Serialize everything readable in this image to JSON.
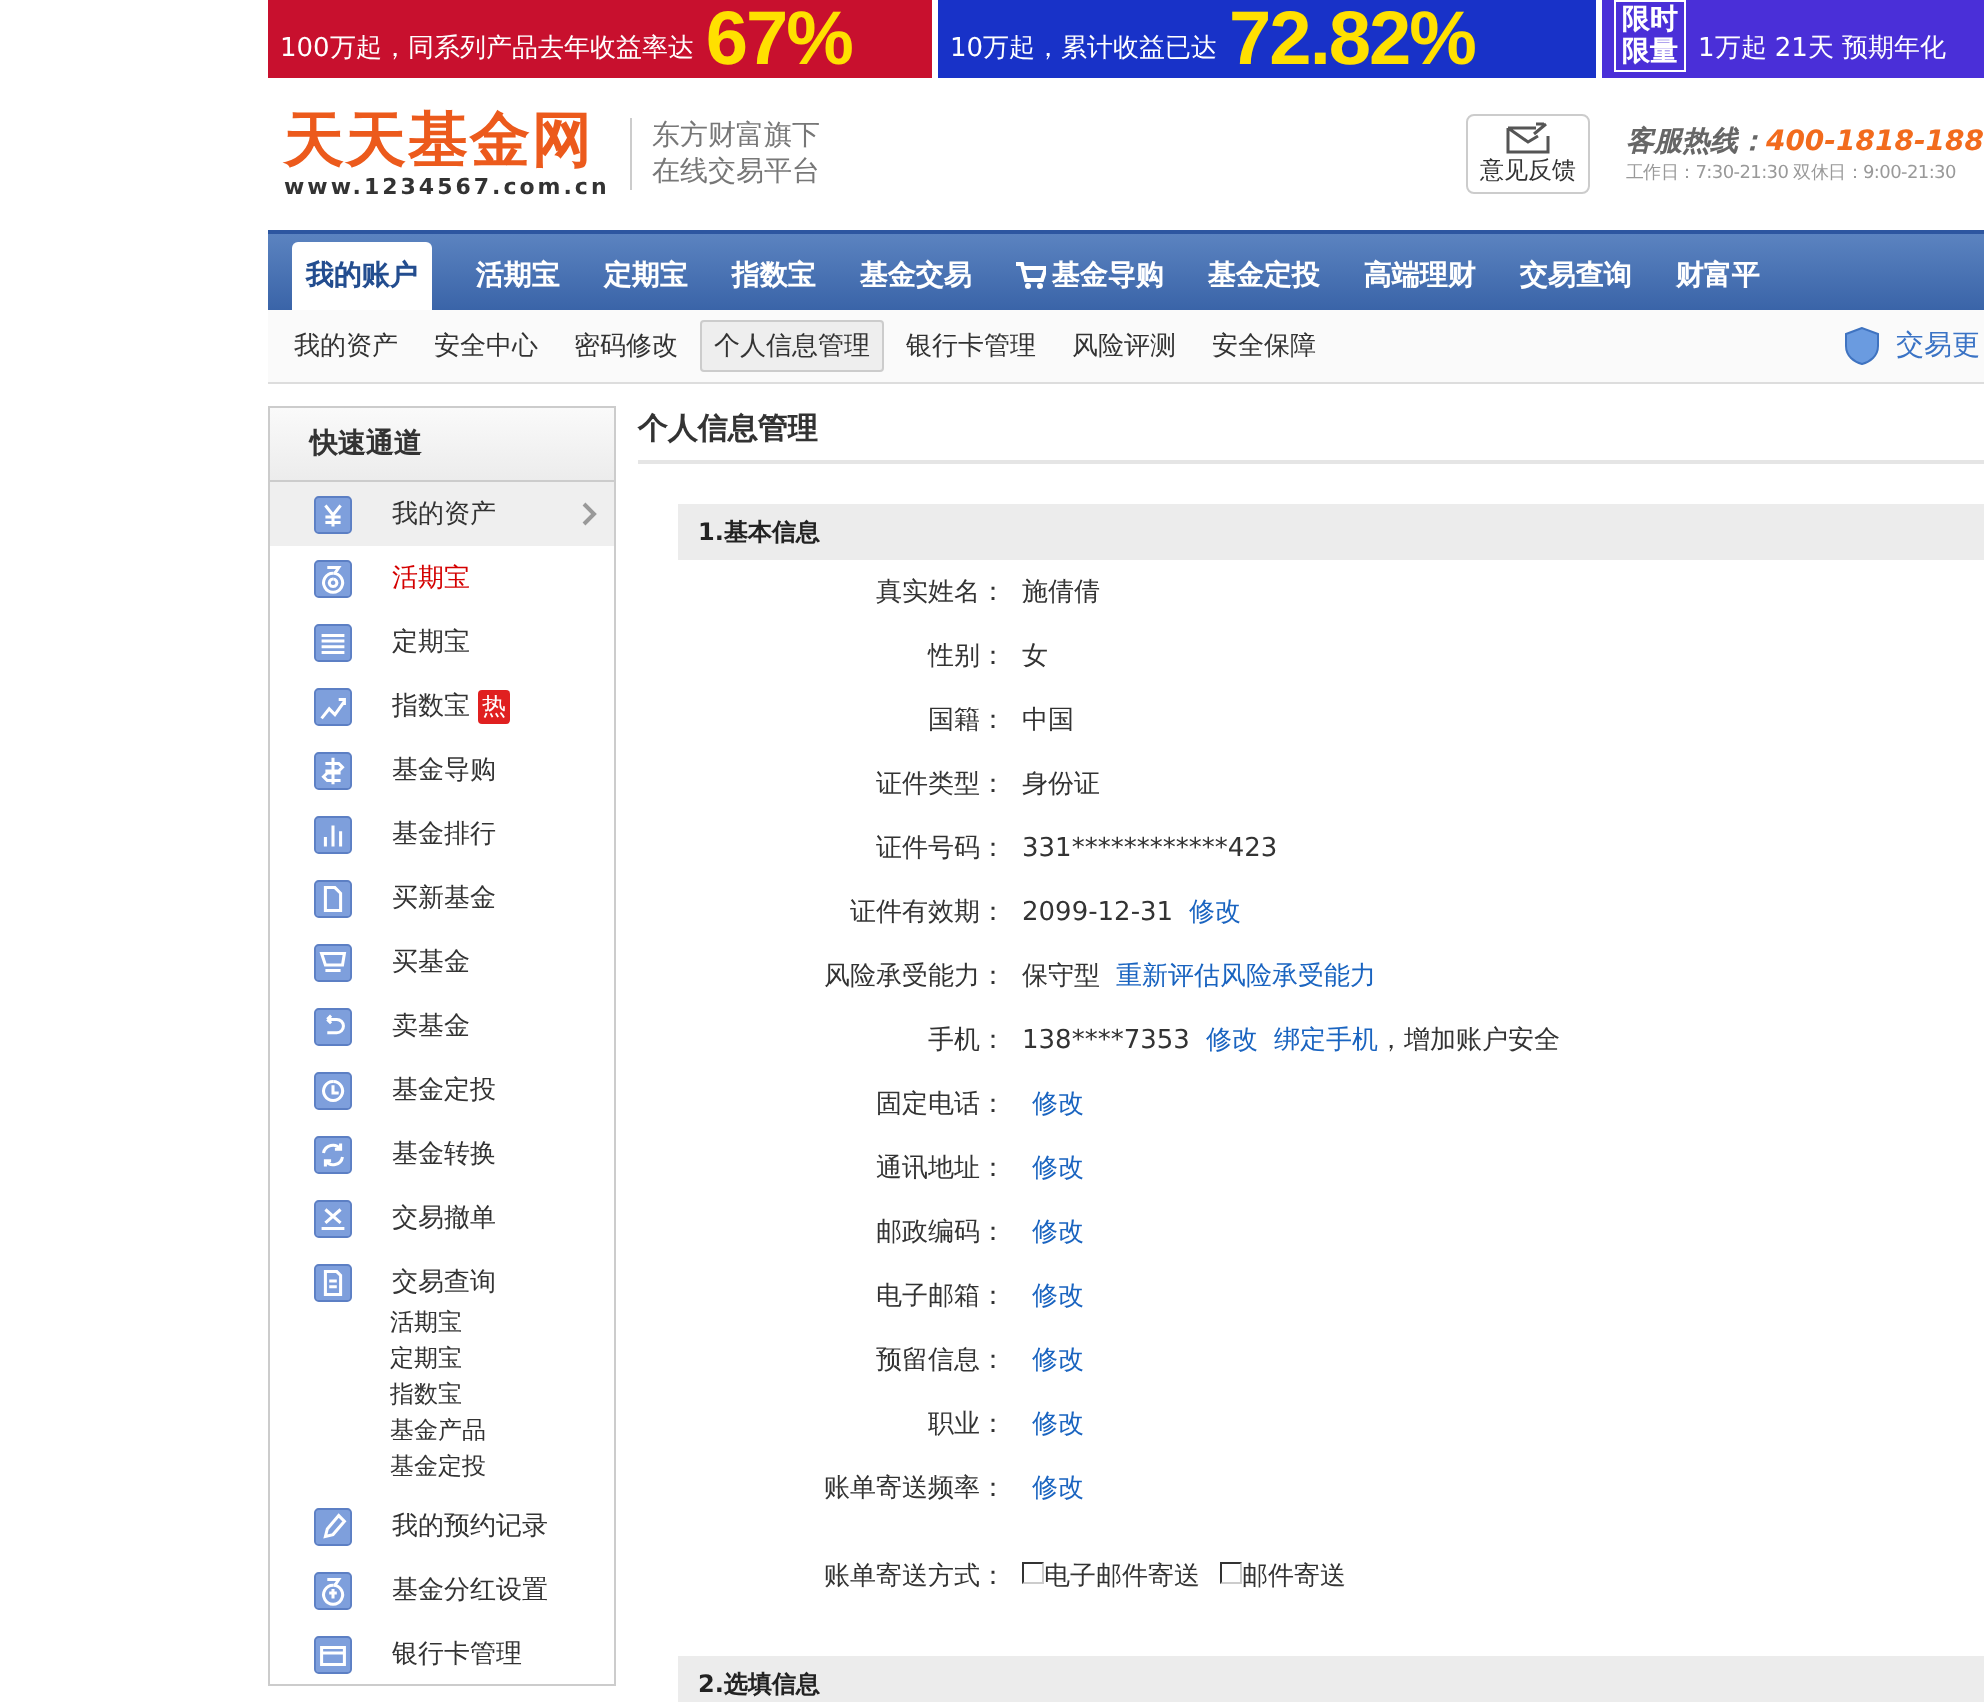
{
  "banners": [
    {
      "color": "#c8102e",
      "caption": "100万起，同系列产品去年收益率达",
      "figure": "67%"
    },
    {
      "color": "#1832c8",
      "caption": "10万起，累计收益已达",
      "figure": "72.82%"
    },
    {
      "color": "#4a2fd8",
      "tag_lines": [
        "限时",
        "限量"
      ],
      "caption": "1万起  21天  预期年化"
    }
  ],
  "header": {
    "logo": "天天基金网",
    "logo_url": "www.1234567.com.cn",
    "slogan": [
      "东方财富旗下",
      "在线交易平台"
    ],
    "feedback": "意见反馈",
    "hotline_label": "客服热线：",
    "hotline_number": "400-1818-188",
    "hours": "工作日：7:30-21:30  双休日：9:00-21:30"
  },
  "nav": {
    "tabs": [
      {
        "label": "我的账户",
        "selected": true,
        "kind": "plain"
      },
      {
        "label": "活期宝",
        "selected": false,
        "kind": "plain"
      },
      {
        "label": "定期宝",
        "selected": false,
        "kind": "plain"
      },
      {
        "label": "指数宝",
        "selected": false,
        "kind": "plain"
      },
      {
        "label": "基金交易",
        "selected": false,
        "kind": "plain"
      },
      {
        "label": "基金导购",
        "selected": false,
        "kind": "cart"
      },
      {
        "label": "基金定投",
        "selected": false,
        "kind": "plain"
      },
      {
        "label": "高端理财",
        "selected": false,
        "kind": "plain"
      },
      {
        "label": "交易查询",
        "selected": false,
        "kind": "plain"
      },
      {
        "label": "财富平",
        "selected": false,
        "kind": "plain"
      }
    ]
  },
  "subnav": {
    "items": [
      {
        "label": "我的资产",
        "selected": false
      },
      {
        "label": "安全中心",
        "selected": false
      },
      {
        "label": "密码修改",
        "selected": false
      },
      {
        "label": "个人信息管理",
        "selected": true
      },
      {
        "label": "银行卡管理",
        "selected": false
      },
      {
        "label": "风险评测",
        "selected": false
      },
      {
        "label": "安全保障",
        "selected": false
      }
    ],
    "right_link": "交易更"
  },
  "sidebar": {
    "title": "快速通道",
    "items": [
      {
        "label": "我的资产",
        "selected": true,
        "highlighted": false
      },
      {
        "label": "活期宝",
        "selected": false,
        "highlighted": true
      },
      {
        "label": "定期宝",
        "selected": false,
        "highlighted": false
      },
      {
        "label": "指数宝",
        "selected": false,
        "highlighted": false,
        "badge": "热"
      },
      {
        "label": "基金导购",
        "selected": false,
        "highlighted": false
      },
      {
        "label": "基金排行",
        "selected": false,
        "highlighted": false
      },
      {
        "label": "买新基金",
        "selected": false,
        "highlighted": false
      },
      {
        "label": "买基金",
        "selected": false,
        "highlighted": false
      },
      {
        "label": "卖基金",
        "selected": false,
        "highlighted": false
      },
      {
        "label": "基金定投",
        "selected": false,
        "highlighted": false
      },
      {
        "label": "基金转换",
        "selected": false,
        "highlighted": false
      },
      {
        "label": "交易撤单",
        "selected": false,
        "highlighted": false
      },
      {
        "label": "交易查询",
        "selected": false,
        "highlighted": false,
        "children": [
          {
            "label": "活期宝"
          },
          {
            "label": "定期宝"
          },
          {
            "label": "指数宝"
          },
          {
            "label": "基金产品"
          },
          {
            "label": "基金定投"
          }
        ]
      },
      {
        "label": "我的预约记录",
        "selected": false,
        "highlighted": false
      },
      {
        "label": "基金分红设置",
        "selected": false,
        "highlighted": false
      },
      {
        "label": "银行卡管理",
        "selected": false,
        "highlighted": false
      }
    ]
  },
  "content": {
    "title": "个人信息管理",
    "sections": [
      {
        "title": "1.基本信息",
        "rows": [
          {
            "label": "真实姓名：",
            "kind": "parts",
            "parts": [
              {
                "kind": "text",
                "text": "施倩倩"
              }
            ]
          },
          {
            "label": "性别：",
            "kind": "parts",
            "parts": [
              {
                "kind": "text",
                "text": "女"
              }
            ]
          },
          {
            "label": "国籍：",
            "kind": "parts",
            "parts": [
              {
                "kind": "text",
                "text": "中国"
              }
            ]
          },
          {
            "label": "证件类型：",
            "kind": "parts",
            "parts": [
              {
                "kind": "text",
                "text": "身份证"
              }
            ]
          },
          {
            "label": "证件号码：",
            "kind": "parts",
            "parts": [
              {
                "kind": "text",
                "text": "331************423"
              }
            ]
          },
          {
            "label": "证件有效期：",
            "kind": "parts",
            "parts": [
              {
                "kind": "text",
                "text": "2099-12-31"
              },
              {
                "kind": "link",
                "text": "修改"
              }
            ]
          },
          {
            "label": "风险承受能力：",
            "kind": "parts",
            "parts": [
              {
                "kind": "text",
                "text": "保守型"
              },
              {
                "kind": "link",
                "text": "重新评估风险承受能力"
              }
            ]
          },
          {
            "label": "手机：",
            "kind": "parts",
            "parts": [
              {
                "kind": "text",
                "text": "138****7353"
              },
              {
                "kind": "link",
                "text": "修改"
              },
              {
                "kind": "link",
                "text": "绑定手机"
              },
              {
                "kind": "note",
                "text": "，增加账户安全"
              }
            ]
          },
          {
            "label": "固定电话：",
            "kind": "parts",
            "parts": [
              {
                "kind": "link",
                "text": "修改"
              }
            ]
          },
          {
            "label": "通讯地址：",
            "kind": "parts",
            "parts": [
              {
                "kind": "link",
                "text": "修改"
              }
            ]
          },
          {
            "label": "邮政编码：",
            "kind": "parts",
            "parts": [
              {
                "kind": "link",
                "text": "修改"
              }
            ]
          },
          {
            "label": "电子邮箱：",
            "kind": "parts",
            "parts": [
              {
                "kind": "link",
                "text": "修改"
              }
            ]
          },
          {
            "label": "预留信息：",
            "kind": "parts",
            "parts": [
              {
                "kind": "link",
                "text": "修改"
              }
            ]
          },
          {
            "label": "职业：",
            "kind": "parts",
            "parts": [
              {
                "kind": "link",
                "text": "修改"
              }
            ]
          },
          {
            "label": "账单寄送频率：",
            "kind": "parts",
            "parts": [
              {
                "kind": "link",
                "text": "修改"
              }
            ]
          },
          {
            "label": "账单寄送方式：",
            "kind": "checkboxes",
            "options": [
              {
                "label": "电子邮件寄送",
                "checked": false
              },
              {
                "label": "邮件寄送",
                "checked": false
              }
            ]
          }
        ]
      },
      {
        "title": "2.选填信息"
      }
    ]
  }
}
